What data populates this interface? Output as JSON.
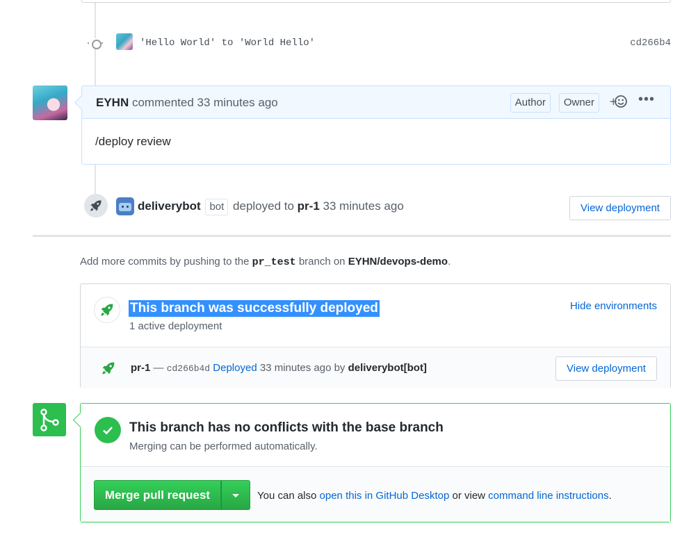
{
  "commit": {
    "message": "'Hello World' to 'World Hello'",
    "sha": "cd266b4"
  },
  "comment": {
    "author": "EYHN",
    "action": "commented 33 minutes ago",
    "badge_author": "Author",
    "badge_owner": "Owner",
    "reaction_label": "+☻",
    "more_label": "•••",
    "body": "/deploy review"
  },
  "deploy_event": {
    "actor": "deliverybot",
    "bot_tag": "bot",
    "text_before": "deployed to",
    "environment": "pr-1",
    "time": "33 minutes ago",
    "button": "View deployment"
  },
  "push_note": {
    "prefix": "Add more commits by pushing to the",
    "branch": "pr_test",
    "middle": "branch on",
    "repo": "EYHN/devops-demo",
    "suffix": "."
  },
  "deployments": {
    "title": "This branch was successfully deployed",
    "count": "1 active deployment",
    "toggle": "Hide environments",
    "row": {
      "env": "pr-1",
      "dash": "—",
      "sha": "cd266b4d",
      "status": "Deployed",
      "time": "33 minutes ago by",
      "by": "deliverybot[bot]",
      "button": "View deployment"
    }
  },
  "merge": {
    "title": "This branch has no conflicts with the base branch",
    "subtitle": "Merging can be performed automatically.",
    "button": "Merge pull request",
    "also_prefix": "You can also",
    "desktop_link": "open this in GitHub Desktop",
    "or_view": "or view",
    "cli_link": "command line instructions",
    "suffix": "."
  },
  "colors": {
    "link": "#0366d6",
    "success": "#2cbe4e",
    "highlight": "#3390ff"
  },
  "icons": [
    "commit-icon",
    "rocket-icon",
    "check-icon",
    "git-merge-icon",
    "smiley-icon",
    "kebab-icon",
    "caret-down-icon"
  ]
}
